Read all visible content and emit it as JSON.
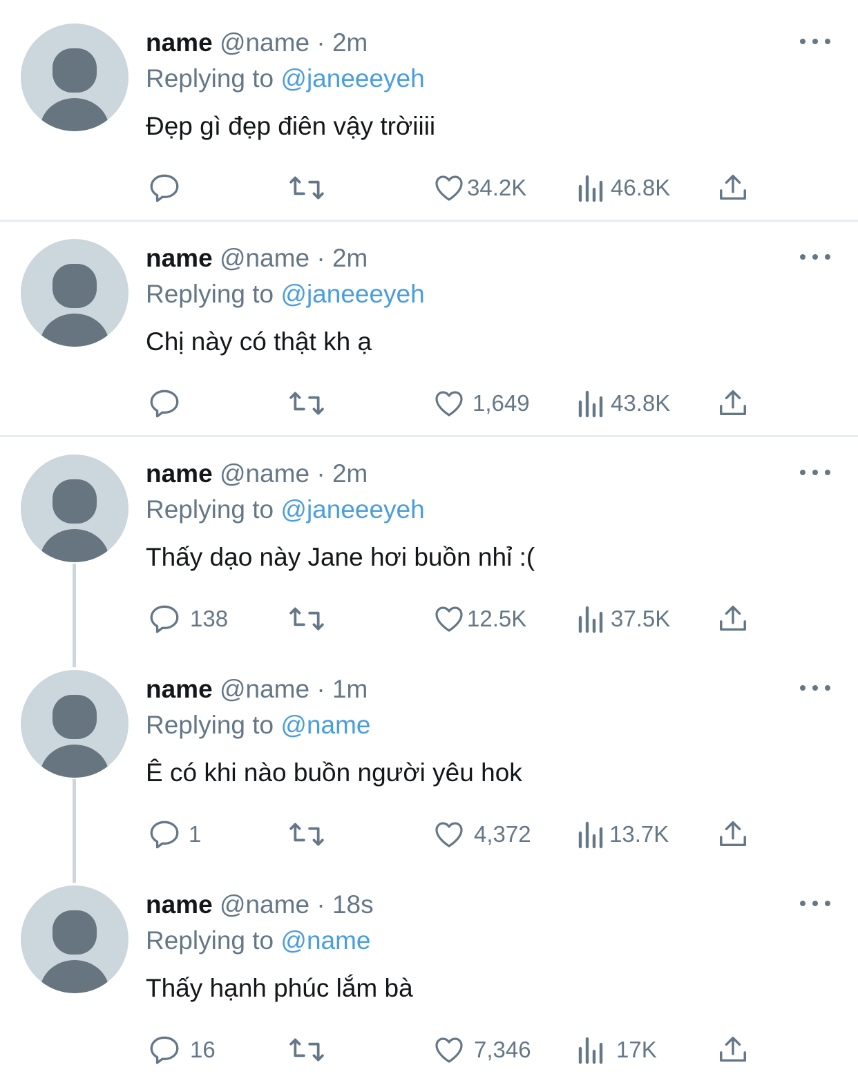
{
  "tweets": [
    {
      "name": "name",
      "handle": "@name",
      "sep": "·",
      "time": "2m",
      "replying_prefix": "Replying to",
      "replying_to": "@janeeeyeh",
      "text": "Đẹp gì đẹp điên vậy trờiiii",
      "replies": "",
      "likes": "34.2K",
      "views": "46.8K"
    },
    {
      "name": "name",
      "handle": "@name",
      "sep": "·",
      "time": "2m",
      "replying_prefix": "Replying to",
      "replying_to": "@janeeeyeh",
      "text": "Chị này có thật kh ạ",
      "replies": "",
      "likes": "1,649",
      "views": "43.8K"
    },
    {
      "name": "name",
      "handle": "@name",
      "sep": "·",
      "time": "2m",
      "replying_prefix": "Replying to",
      "replying_to": "@janeeeyeh",
      "text": "Thấy dạo này Jane hơi buồn nhỉ :(",
      "replies": "138",
      "likes": "12.5K",
      "views": "37.5K"
    },
    {
      "name": "name",
      "handle": "@name",
      "sep": "·",
      "time": "1m",
      "replying_prefix": "Replying to",
      "replying_to": "@name",
      "text": "Ê có khi nào buồn người yêu hok",
      "replies": "1",
      "likes": "4,372",
      "views": "13.7K"
    },
    {
      "name": "name",
      "handle": "@name",
      "sep": "·",
      "time": "18s",
      "replying_prefix": "Replying to",
      "replying_to": "@name",
      "text": "Thấy hạnh phúc lắm bà",
      "replies": "16",
      "likes": "7,346",
      "views": "17K"
    }
  ],
  "colors": {
    "primary_text": "#14171a",
    "secondary_text": "#657786",
    "link": "#4a9de0",
    "avatar_bg": "#ccd6dd",
    "avatar_fg": "#66757f",
    "divider": "#e6ecf0"
  },
  "icons": [
    "more-icon",
    "reply-icon",
    "retweet-icon",
    "like-icon",
    "views-icon",
    "share-icon"
  ]
}
